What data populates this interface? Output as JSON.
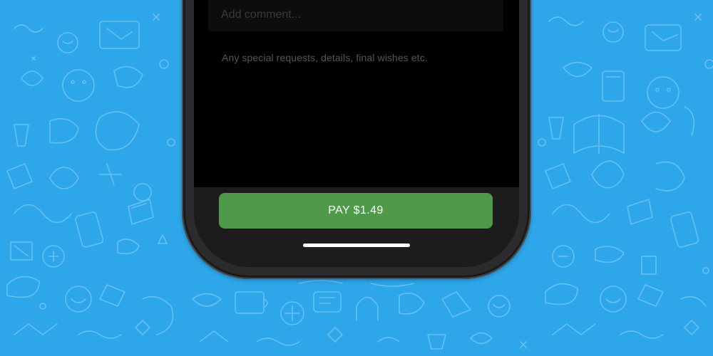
{
  "wallpaper": {
    "background_color": "#2ea6ea",
    "doodle_color": "#6cc3f2",
    "style": "doodle-pattern"
  },
  "phone": {
    "frame_color": "#2b2b2d",
    "screen_color": "#000000"
  },
  "comment": {
    "placeholder": "Add comment...",
    "hint": "Any special requests, details, final wishes etc."
  },
  "payment": {
    "button_label": "PAY $1.49",
    "button_color": "#4e9a49"
  }
}
